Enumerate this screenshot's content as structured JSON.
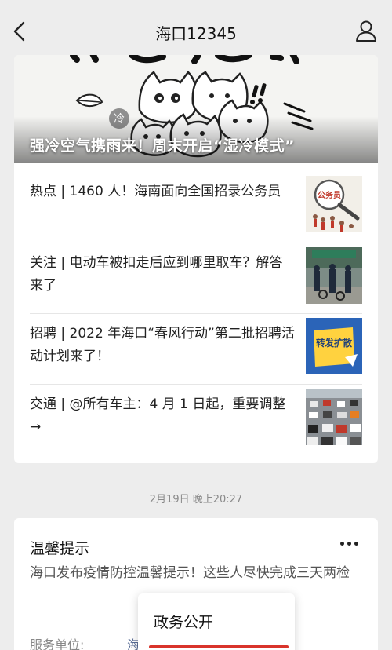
{
  "header": {
    "title": "海口12345",
    "back_icon": "chevron-left-icon",
    "profile_icon": "user-icon"
  },
  "banner": {
    "title": "强冷空气携雨来！周末开启“湿冷模式”"
  },
  "articles": [
    {
      "title": "热点 | 1460 人！海南面向全国招录公务员",
      "thumb_text": "公务员"
    },
    {
      "title": "关注 | 电动车被扣走后应到哪里取车？解答来了",
      "thumb_text": ""
    },
    {
      "title": "招聘 | 2022 年海口“春风行动”第二批招聘活动计划来了！",
      "thumb_text": "转发扩散"
    },
    {
      "title": "交通 | @所有车主：4 月 1 日起，重要调整 →",
      "thumb_text": ""
    }
  ],
  "timestamp": "2月19日 晚上20:27",
  "notice": {
    "heading": "温馨提示",
    "body": "海口发布疫情防控温馨提示！这些人尽快完成三天两检",
    "service_label": "服务单位:",
    "service_value": "海"
  },
  "popup_menu": {
    "item": "政务公开"
  },
  "colors": {
    "background": "#ededed",
    "card": "#ffffff",
    "link": "#576b95",
    "accent_red": "#d9342b"
  }
}
